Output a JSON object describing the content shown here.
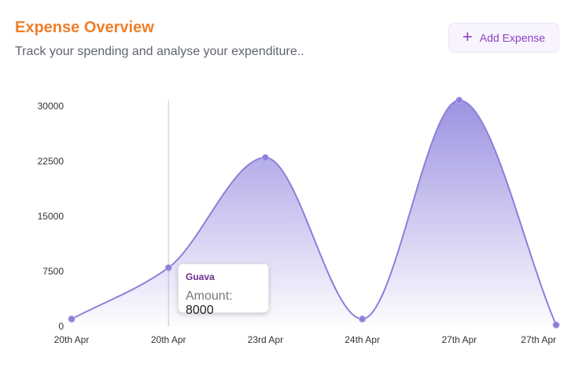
{
  "header": {
    "title": "Expense Overview",
    "subtitle": "Track your spending and analyse your expenditure..",
    "add_button_label": "Add Expense",
    "add_button_icon": "plus-icon"
  },
  "tooltip": {
    "title": "Guava",
    "label": "Amount:",
    "value": "8000"
  },
  "colors": {
    "title": "#ee7f2a",
    "line": "#8b80d8",
    "area_top": "#9b92e0",
    "button_text": "#8a3fc6"
  },
  "chart_data": {
    "type": "area",
    "x": [
      "20th Apr",
      "20th Apr",
      "23rd Apr",
      "24th Apr",
      "27th Apr",
      "27th Apr"
    ],
    "values": [
      1000,
      8000,
      23000,
      1000,
      30800,
      200
    ],
    "yticks": [
      0,
      7500,
      15000,
      22500,
      30000
    ],
    "ylim": [
      0,
      30000
    ],
    "grid": false,
    "smooth": true,
    "active_index": 1
  }
}
